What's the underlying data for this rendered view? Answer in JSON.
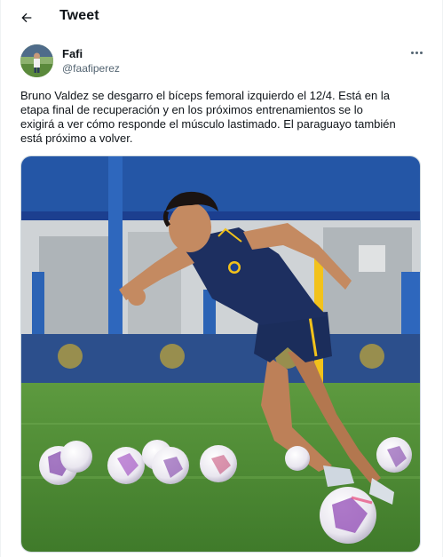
{
  "header": {
    "title": "Tweet",
    "back_icon": "arrow-left-icon"
  },
  "author": {
    "name": "Fafi",
    "handle": "@faafiperez",
    "more_icon": "more-horizontal-icon"
  },
  "tweet": {
    "text": "Bruno Valdez se desgarro el bíceps femoral izquierdo el 12/4. Está en la\netapa final de recuperación y en los próximos entrenamientos se lo\nexigirá a ver cómo responde el músculo lastimado. El paraguayo también\nestá próximo a volver."
  },
  "colors": {
    "text": "#0f1419",
    "secondary": "#536471",
    "border": "#cfd9de",
    "grass": "#4f8f36",
    "boca_blue": "#1c3f8f",
    "boca_yellow": "#f2c21b"
  }
}
